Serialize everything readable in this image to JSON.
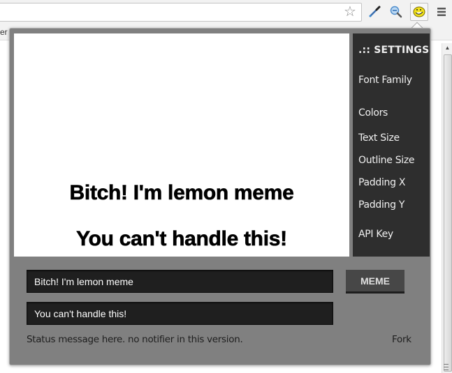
{
  "browser": {
    "icons": {
      "bookmark_star": "star-icon",
      "eyedropper": "eyedropper-icon",
      "zoom": "magnifier-icon",
      "extension": "trollface-extension-icon",
      "menu": "hamburger-menu-icon"
    },
    "bookmarks_partial_text": "er"
  },
  "preview": {
    "top_text": "Bitch! I'm lemon meme",
    "bottom_text": "You can't handle this!"
  },
  "settings": {
    "title": ".:: SETTINGS",
    "items": [
      {
        "label": "Font Family"
      },
      {
        "label": "Colors"
      },
      {
        "label": "Text Size"
      },
      {
        "label": "Outline Size"
      },
      {
        "label": "Padding X"
      },
      {
        "label": "Padding Y"
      },
      {
        "label": "API Key"
      }
    ]
  },
  "controls": {
    "top_input_value": "Bitch! I'm lemon meme",
    "bottom_input_value": "You can't handle this!",
    "meme_button_label": "MEME",
    "status_message": "Status message here. no notifier in this version.",
    "fork_link": "Fork"
  },
  "colors": {
    "popup_bg": "#808080",
    "settings_bg": "#2e2e2e",
    "input_bg": "#1f1f1f",
    "button_bg": "#474747"
  }
}
